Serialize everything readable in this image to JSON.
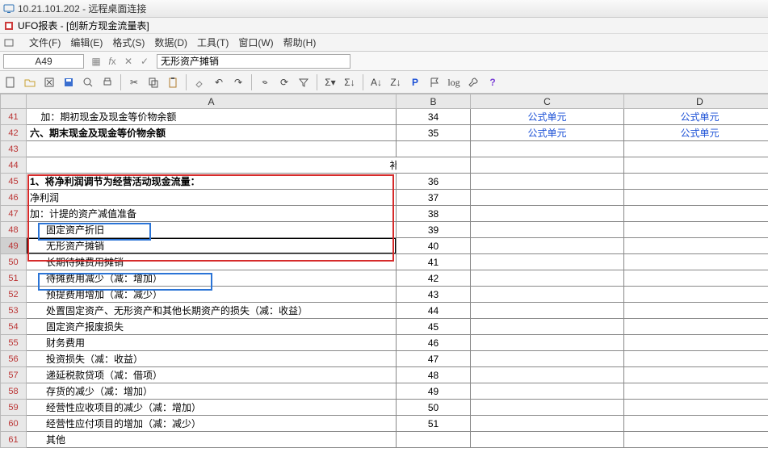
{
  "window": {
    "remote_title": "10.21.101.202 - 远程桌面连接",
    "app_title": "UFO报表 - [创新方现金流量表]"
  },
  "menus": [
    "文件(F)",
    "编辑(E)",
    "格式(S)",
    "数据(D)",
    "工具(T)",
    "窗口(W)",
    "帮助(H)"
  ],
  "namebox": "A49",
  "formula": "无形资产摊销",
  "col_headers": [
    "",
    "A",
    "B",
    "C",
    "D"
  ],
  "formula_link": "公式单元",
  "rows": [
    {
      "n": 41,
      "a": "    加：期初现金及现金等价物余额",
      "b": "34",
      "c": "link",
      "d": "link"
    },
    {
      "n": 42,
      "a": "六、期末现金及现金等价物余额",
      "b": "35",
      "c": "link",
      "d": "link",
      "bold": true
    },
    {
      "n": 43,
      "a": "",
      "b": ""
    },
    {
      "n": 44,
      "a": "",
      "b": "补充资料",
      "b_merge": true
    },
    {
      "n": 45,
      "a": "1、将净利润调节为经营活动现金流量：",
      "b": "36",
      "bold": true
    },
    {
      "n": 46,
      "a": "净利润",
      "b": "37"
    },
    {
      "n": 47,
      "a": "加：计提的资产减值准备",
      "b": "38"
    },
    {
      "n": 48,
      "a": "      固定资产折旧",
      "b": "39"
    },
    {
      "n": 49,
      "a": "      无形资产摊销",
      "b": "40",
      "sel": true
    },
    {
      "n": 50,
      "a": "      长期待摊费用摊销",
      "b": "41"
    },
    {
      "n": 51,
      "a": "      待摊费用减少（减：增加）",
      "b": "42"
    },
    {
      "n": 52,
      "a": "      预提费用增加（减：减少）",
      "b": "43"
    },
    {
      "n": 53,
      "a": "      处置固定资产、无形资产和其他长期资产的损失（减：收益）",
      "b": "44"
    },
    {
      "n": 54,
      "a": "      固定资产报废损失",
      "b": "45"
    },
    {
      "n": 55,
      "a": "      财务费用",
      "b": "46"
    },
    {
      "n": 56,
      "a": "      投资损失（减：收益）",
      "b": "47"
    },
    {
      "n": 57,
      "a": "      递延税款贷项（减：借项）",
      "b": "48"
    },
    {
      "n": 58,
      "a": "      存货的减少（减：增加）",
      "b": "49"
    },
    {
      "n": 59,
      "a": "      经营性应收项目的减少（减：增加）",
      "b": "50"
    },
    {
      "n": 60,
      "a": "      经营性应付项目的增加（减：减少）",
      "b": "51"
    },
    {
      "n": 61,
      "a": "      其他",
      "b": ""
    }
  ],
  "chart_data": {
    "type": "table",
    "title": "创新方现金流量表",
    "columns": [
      "A",
      "B",
      "C",
      "D"
    ],
    "rows": [
      [
        "加：期初现金及现金等价物余额",
        "34",
        "公式单元",
        "公式单元"
      ],
      [
        "六、期末现金及现金等价物余额",
        "35",
        "公式单元",
        "公式单元"
      ],
      [
        "",
        "",
        "",
        ""
      ],
      [
        "补充资料",
        "",
        "",
        ""
      ],
      [
        "1、将净利润调节为经营活动现金流量：",
        "36",
        "",
        ""
      ],
      [
        "净利润",
        "37",
        "",
        ""
      ],
      [
        "加：计提的资产减值准备",
        "38",
        "",
        ""
      ],
      [
        "固定资产折旧",
        "39",
        "",
        ""
      ],
      [
        "无形资产摊销",
        "40",
        "",
        ""
      ],
      [
        "长期待摊费用摊销",
        "41",
        "",
        ""
      ],
      [
        "待摊费用减少（减：增加）",
        "42",
        "",
        ""
      ],
      [
        "预提费用增加（减：减少）",
        "43",
        "",
        ""
      ],
      [
        "处置固定资产、无形资产和其他长期资产的损失（减：收益）",
        "44",
        "",
        ""
      ],
      [
        "固定资产报废损失",
        "45",
        "",
        ""
      ],
      [
        "财务费用",
        "46",
        "",
        ""
      ],
      [
        "投资损失（减：收益）",
        "47",
        "",
        ""
      ],
      [
        "递延税款贷项（减：借项）",
        "48",
        "",
        ""
      ],
      [
        "存货的减少（减：增加）",
        "49",
        "",
        ""
      ],
      [
        "经营性应收项目的减少（减：增加）",
        "50",
        "",
        ""
      ],
      [
        "经营性应付项目的增加（减：减少）",
        "51",
        "",
        ""
      ]
    ]
  }
}
